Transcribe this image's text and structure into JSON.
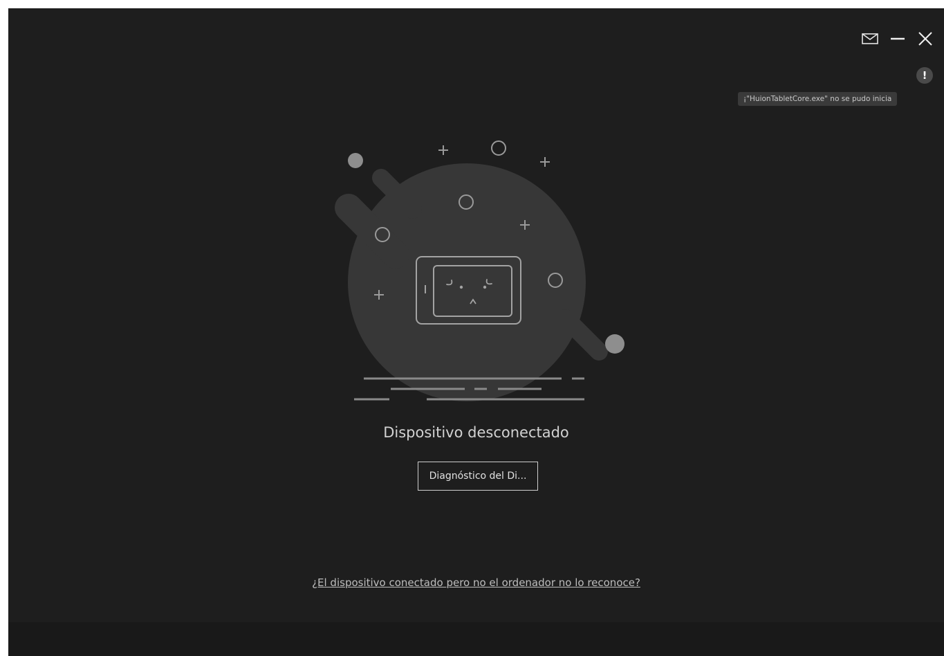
{
  "window": {
    "controls": [
      {
        "name": "feedback",
        "icon": "mail-icon"
      },
      {
        "name": "minimize",
        "icon": "minimize-icon"
      },
      {
        "name": "close",
        "icon": "close-icon"
      }
    ]
  },
  "notification": {
    "icon": "warning-icon",
    "glyph": "!",
    "message": "¡\"HuionTabletCore.exe\" no se pudo inicia"
  },
  "main": {
    "illustration": "disconnected-tablet-illustration",
    "status": "Dispositivo desconectado",
    "diagnose_button": "Diagnóstico del Di...",
    "help_link": "¿El dispositivo conectado pero no el ordenador no lo reconoce?"
  },
  "colors": {
    "background": "#1e1e1e",
    "footer": "#191919",
    "blob": "#373737",
    "line_art": "#8a8a8a",
    "text": "#d2d2d2"
  }
}
